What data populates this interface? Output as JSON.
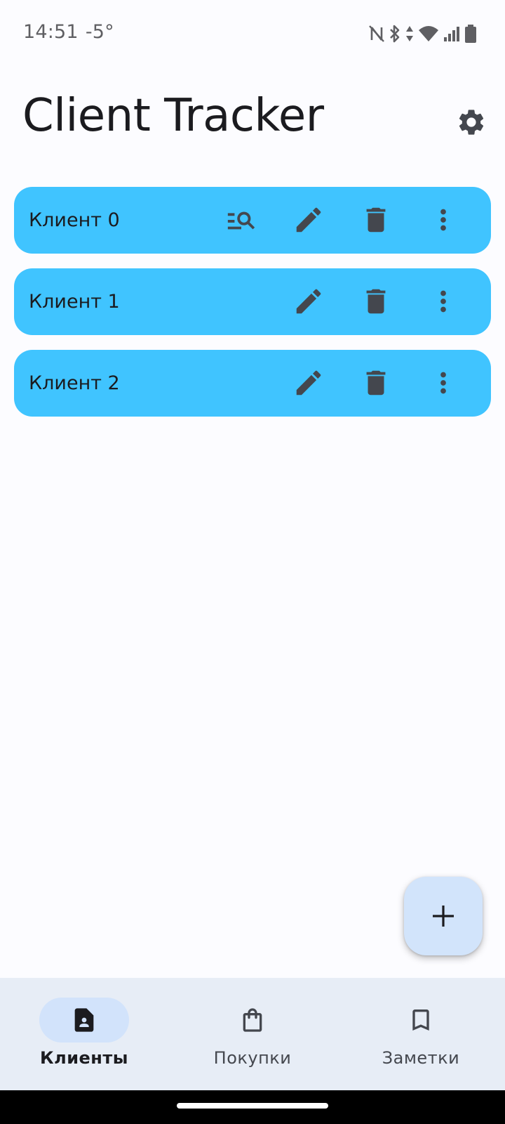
{
  "status_bar": {
    "time": "14:51",
    "temperature": "-5°"
  },
  "header": {
    "title": "Client Tracker"
  },
  "clients": [
    {
      "name": "Клиент 0"
    },
    {
      "name": "Клиент 1"
    },
    {
      "name": "Клиент 2"
    }
  ],
  "bottom_nav": {
    "items": [
      {
        "label": "Клиенты",
        "icon": "contact-page-icon",
        "active": true
      },
      {
        "label": "Покупки",
        "icon": "shopping-bag-icon",
        "active": false
      },
      {
        "label": "Заметки",
        "icon": "bookmark-icon",
        "active": false
      }
    ]
  },
  "colors": {
    "card": "#40C4FF",
    "fab": "#D2E4FB",
    "nav_background": "#E7EDF6",
    "nav_active_pill": "#D2E3FB",
    "icon": "#44474E"
  }
}
